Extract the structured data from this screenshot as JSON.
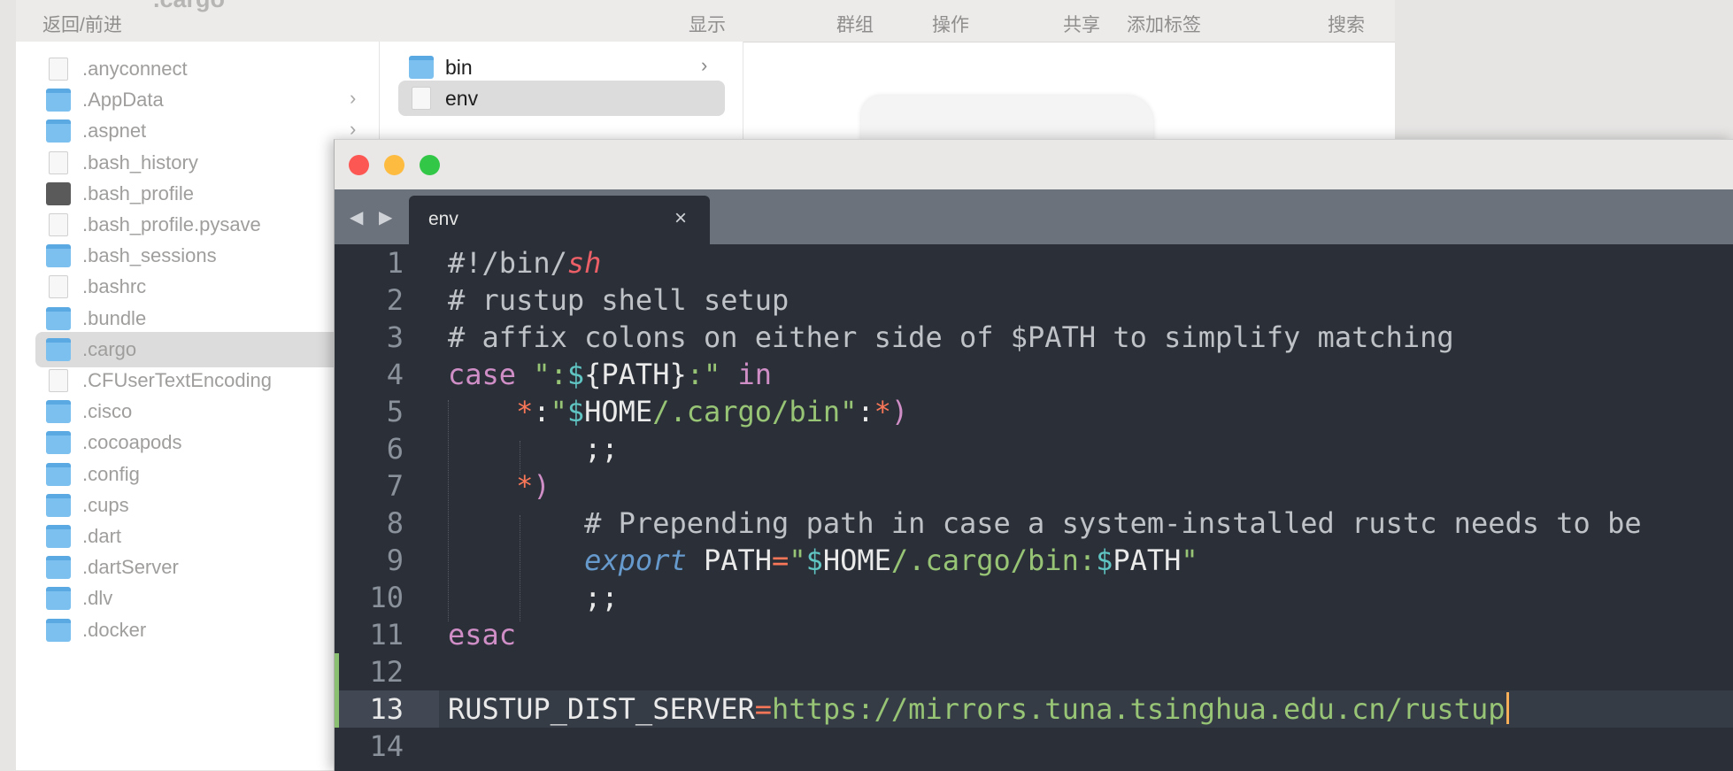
{
  "finder": {
    "title": ".cargo",
    "toolbar": {
      "back_forward": "返回/前进",
      "view": "显示",
      "group": "群组",
      "action": "操作",
      "share": "共享",
      "add_tag": "添加标签",
      "search": "搜索"
    },
    "column1": [
      {
        "name": ".anyconnect",
        "kind": "file"
      },
      {
        "name": ".AppData",
        "kind": "folder",
        "chevron": true
      },
      {
        "name": ".aspnet",
        "kind": "folder",
        "chevron": true
      },
      {
        "name": ".bash_history",
        "kind": "file"
      },
      {
        "name": ".bash_profile",
        "kind": "terminal"
      },
      {
        "name": ".bash_profile.pysave",
        "kind": "file"
      },
      {
        "name": ".bash_sessions",
        "kind": "folder"
      },
      {
        "name": ".bashrc",
        "kind": "file"
      },
      {
        "name": ".bundle",
        "kind": "folder"
      },
      {
        "name": ".cargo",
        "kind": "folder",
        "selected": true
      },
      {
        "name": ".CFUserTextEncoding",
        "kind": "file"
      },
      {
        "name": ".cisco",
        "kind": "folder"
      },
      {
        "name": ".cocoapods",
        "kind": "folder"
      },
      {
        "name": ".config",
        "kind": "folder"
      },
      {
        "name": ".cups",
        "kind": "folder"
      },
      {
        "name": ".dart",
        "kind": "folder"
      },
      {
        "name": ".dartServer",
        "kind": "folder"
      },
      {
        "name": ".dlv",
        "kind": "folder"
      },
      {
        "name": ".docker",
        "kind": "folder"
      }
    ],
    "column2": [
      {
        "name": "bin",
        "kind": "folder",
        "chevron": true
      },
      {
        "name": "env",
        "kind": "file",
        "selected": true
      }
    ],
    "chevron_glyph": "›"
  },
  "editor": {
    "nav_arrows": "◀ ▶",
    "tab": {
      "label": "env",
      "close": "×"
    },
    "traffic_lights": {
      "close": "#fc5753",
      "minimize": "#fdbc40",
      "zoom": "#33c748"
    },
    "line_numbers": [
      "1",
      "2",
      "3",
      "4",
      "5",
      "6",
      "7",
      "8",
      "9",
      "10",
      "11",
      "12",
      "13",
      "14"
    ],
    "active_line": "13",
    "code": {
      "l1": {
        "a": "#!/bin/",
        "b": "sh"
      },
      "l2": "# rustup shell setup",
      "l3": "# affix colons on either side of $PATH to simplify matching",
      "l4": {
        "case": "case",
        "q1": "\":",
        "dollar": "$",
        "brace": "{PATH}",
        "q2": ":\"",
        "in": "in"
      },
      "l5": {
        "star1": "*",
        "colon1": ":",
        "q1": "\"",
        "dollar": "$",
        "home": "HOME",
        "path": "/.cargo/bin",
        "q2": "\"",
        "colon2": ":",
        "star2": "*",
        "paren": ")"
      },
      "l6": ";;",
      "l7": {
        "star": "*",
        "paren": ")"
      },
      "l8": "# Prepending path in case a system-installed rustc needs to be",
      "l9": {
        "export": "export",
        "var": " PATH",
        "eq": "=",
        "q1": "\"",
        "d1": "$",
        "home": "HOME",
        "mid": "/.cargo/bin:",
        "d2": "$",
        "path": "PATH",
        "q2": "\""
      },
      "l10": ";;",
      "l11": "esac",
      "l13": {
        "var": "RUSTUP_DIST_SERVER",
        "eq": "=",
        "val": "https://mirrors.tuna.tsinghua.edu.cn/rustup"
      }
    }
  }
}
